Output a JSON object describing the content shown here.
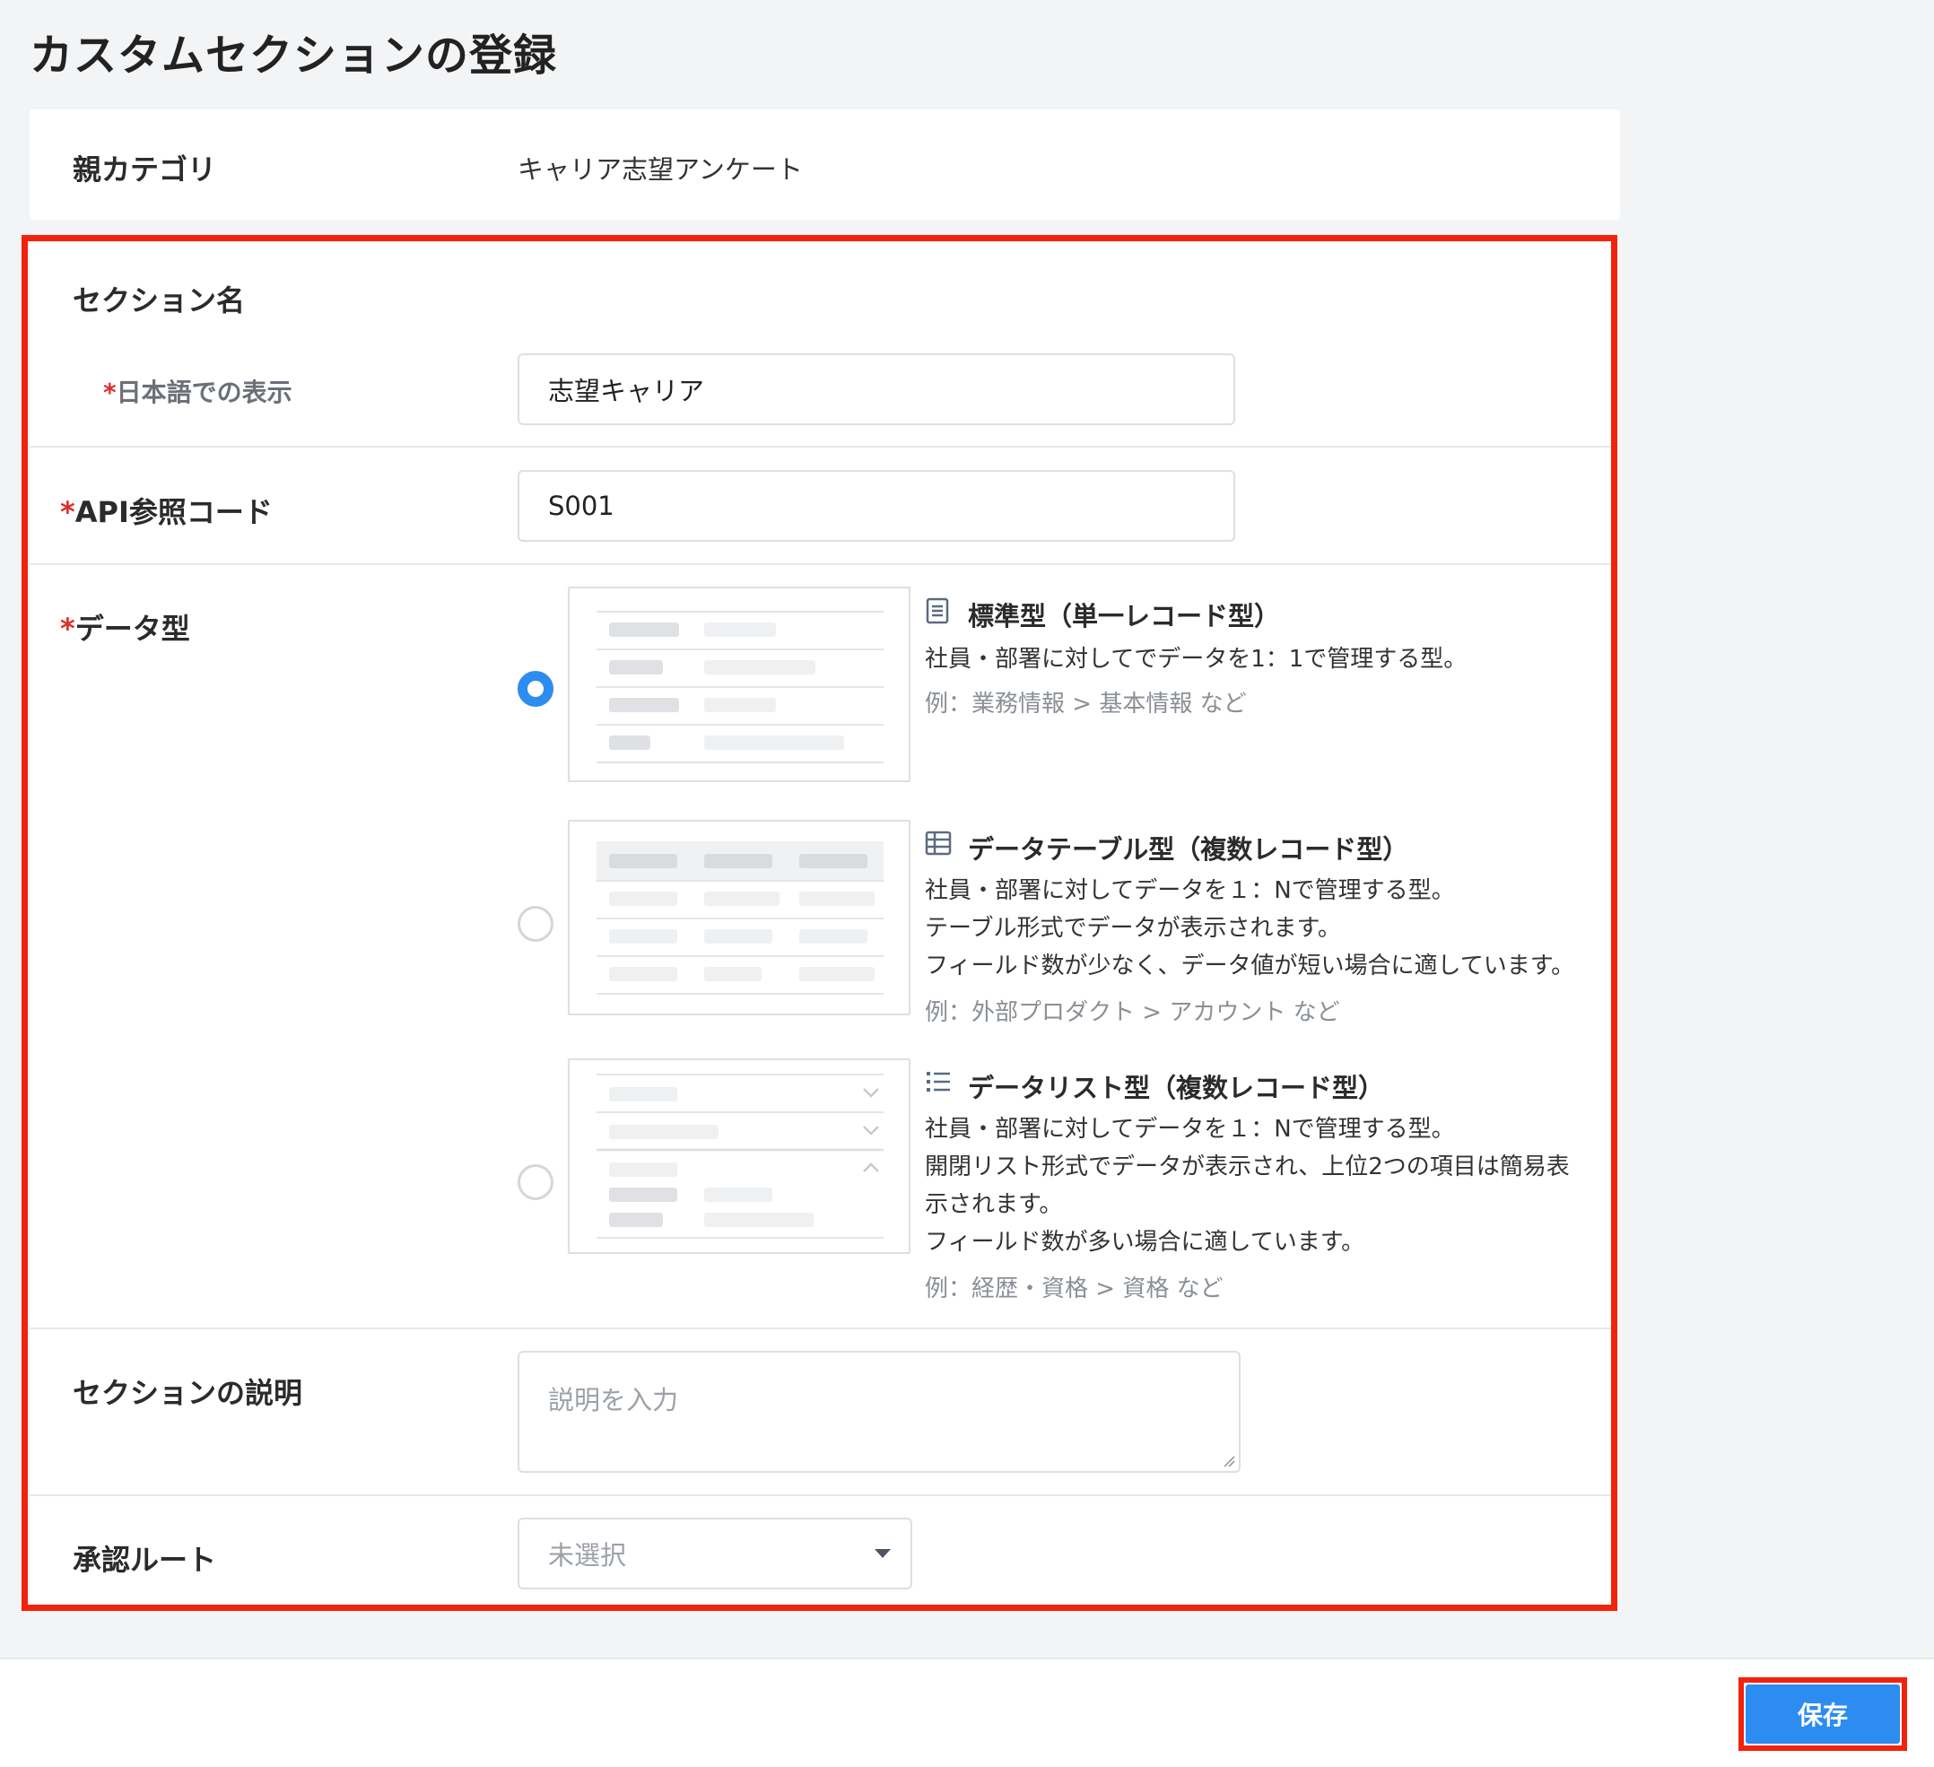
{
  "page": {
    "title": "カスタムセクションの登録"
  },
  "parent_category": {
    "label": "親カテゴリ",
    "value": "キャリア志望アンケート"
  },
  "section_name": {
    "heading": "セクション名",
    "japanese_label_required": "*",
    "japanese_label": "日本語での表示",
    "japanese_value": "志望キャリア"
  },
  "api_code": {
    "required": "*",
    "label": "API参照コード",
    "value": "S001"
  },
  "data_type": {
    "required": "*",
    "label": "データ型",
    "selected": 0,
    "options": [
      {
        "icon": "document-icon",
        "title": "標準型（単一レコード型）",
        "lines": [
          "社員・部署に対してでデータを1：1で管理する型。"
        ],
        "example": "例：業務情報 > 基本情報 など"
      },
      {
        "icon": "table-icon",
        "title": "データテーブル型（複数レコード型）",
        "lines": [
          "社員・部署に対してデータを１：Nで管理する型。",
          "テーブル形式でデータが表示されます。",
          "フィールド数が少なく、データ値が短い場合に適しています。"
        ],
        "example": "例：外部プロダクト > アカウント など"
      },
      {
        "icon": "list-icon",
        "title": "データリスト型（複数レコード型）",
        "lines": [
          "社員・部署に対してデータを１：Nで管理する型。",
          "開閉リスト形式でデータが表示され、上位2つの項目は簡易表",
          "示されます。",
          "フィールド数が多い場合に適しています。"
        ],
        "example": "例：経歴・資格 > 資格 など"
      }
    ]
  },
  "description": {
    "label": "セクションの説明",
    "placeholder": "説明を入力"
  },
  "approval_route": {
    "label": "承認ルート",
    "placeholder": "未選択"
  },
  "footer": {
    "save_label": "保存"
  },
  "colors": {
    "accent": "#2d8cf0",
    "highlight": "#f2230c",
    "required": "#e02d2d"
  }
}
